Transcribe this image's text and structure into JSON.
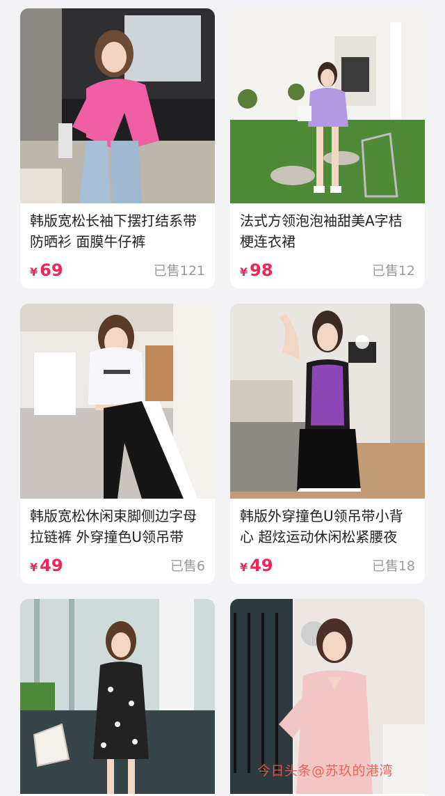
{
  "products": [
    {
      "title": "韩版宽松长袖下摆打结系带防晒衫 面膜牛仔裤",
      "currency": "¥",
      "price": "69",
      "sold": "已售121",
      "image": "photo-pink-top-jeans"
    },
    {
      "title": "法式方领泡泡袖甜美A字桔梗连衣裙",
      "currency": "¥",
      "price": "98",
      "sold": "已售12",
      "image": "photo-lavender-dress-garden"
    },
    {
      "title": "韩版宽松休闲束脚侧边字母拉链裤 外穿撞色U领吊带",
      "currency": "¥",
      "price": "49",
      "sold": "已售6",
      "image": "photo-white-tee-black-pants"
    },
    {
      "title": "韩版外穿撞色U领吊带小背心 超炫运动休闲松紧腰夜",
      "currency": "¥",
      "price": "49",
      "sold": "已售18",
      "image": "photo-purple-tank-shorts"
    },
    {
      "image": "photo-floral-dress-glass-room"
    },
    {
      "image": "photo-pink-pajamas-bathroom"
    }
  ],
  "watermark": "今日头条@苏玖的港湾",
  "colors": {
    "price": "#ef2756",
    "sold": "#9a9a9a",
    "background": "#f3f3f5"
  }
}
